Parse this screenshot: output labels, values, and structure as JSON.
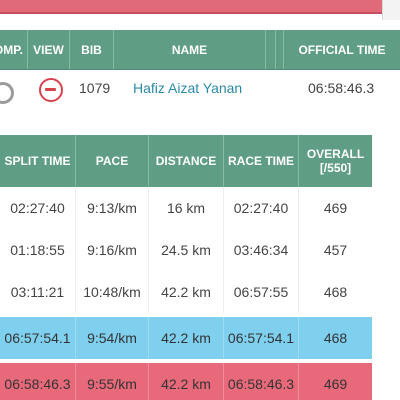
{
  "colors": {
    "header_green": "#5f9e84",
    "name_link": "#2a8aa8",
    "highlight_blue": "#7fd0ee",
    "highlight_red": "#e86a7a",
    "remove_icon": "#d9424d"
  },
  "results_header": {
    "comp": "OMP.",
    "view": "VIEW",
    "bib": "BIB",
    "name": "NAME",
    "official_time": "OFFICIAL TIME"
  },
  "runner": {
    "bib": "1079",
    "name": "Hafiz Aizat Yanan",
    "official_time": "06:58:46.3",
    "compare_icon": "circle-toggle-icon",
    "view_icon": "remove-circle-icon"
  },
  "splits": {
    "headers": [
      "SPLIT TIME",
      "PACE",
      "DISTANCE",
      "RACE TIME",
      "OVERALL [/550]"
    ],
    "rows": [
      {
        "split_time": "02:27:40",
        "pace": "9:13/km",
        "distance": "16 km",
        "race_time": "02:27:40",
        "overall": "469"
      },
      {
        "split_time": "01:18:55",
        "pace": "9:16/km",
        "distance": "24.5 km",
        "race_time": "03:46:34",
        "overall": "457"
      },
      {
        "split_time": "03:11:21",
        "pace": "10:48/km",
        "distance": "42.2 km",
        "race_time": "06:57:55",
        "overall": "468"
      },
      {
        "split_time": "06:57:54.1",
        "pace": "9:54/km",
        "distance": "42.2 km",
        "race_time": "06:57:54.1",
        "overall": "468"
      },
      {
        "split_time": "06:58:46.3",
        "pace": "9:55/km",
        "distance": "42.2 km",
        "race_time": "06:58:46.3",
        "overall": "469"
      }
    ]
  }
}
